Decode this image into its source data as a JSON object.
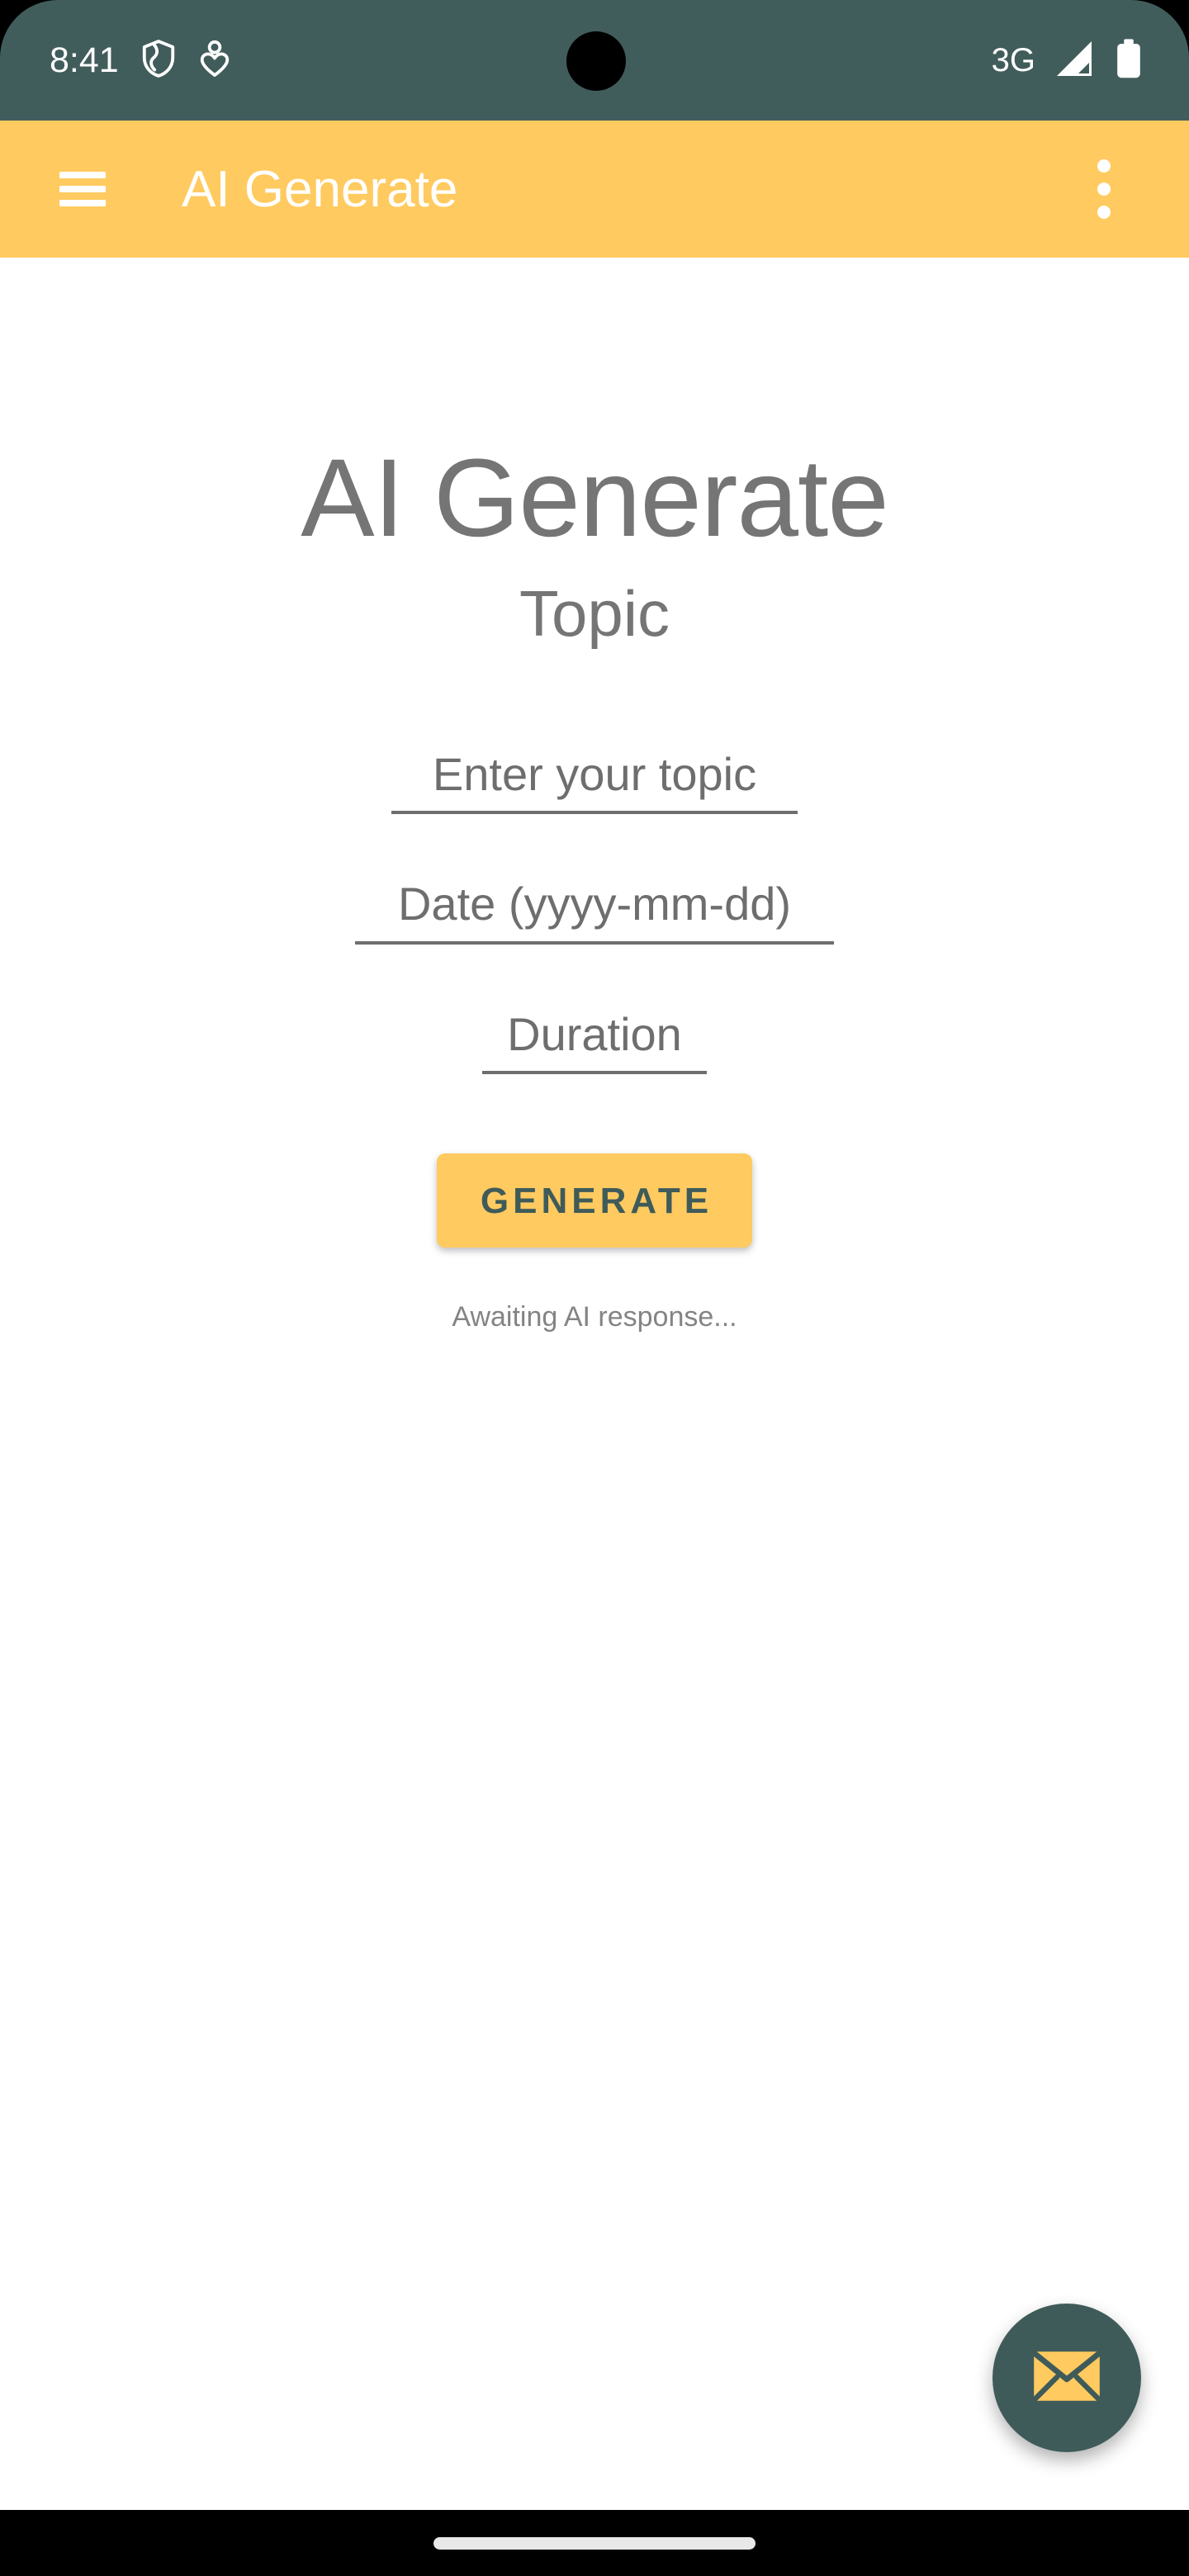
{
  "status_bar": {
    "time": "8:41",
    "network_type": "3G",
    "icons": {
      "vpn": "shield-icon",
      "person": "person-heart-icon",
      "signal": "signal-bars-icon",
      "battery": "battery-full-icon",
      "camera": "camera-cutout"
    },
    "background_color": "#415D5B",
    "foreground_color": "#FFFFFF"
  },
  "app_bar": {
    "title": "AI Generate",
    "menu_icon": "hamburger-menu-icon",
    "overflow_icon": "more-vert-icon",
    "background_color": "#FFCA5F",
    "title_color": "#FFFFFF"
  },
  "main": {
    "page_title": "AI Generate",
    "section_subtitle": "Topic",
    "fields": [
      {
        "name": "topic",
        "value": "",
        "placeholder": "Enter your topic"
      },
      {
        "name": "date",
        "value": "",
        "placeholder": "Date (yyyy-mm-dd)"
      },
      {
        "name": "duration",
        "value": "",
        "placeholder": "Duration"
      }
    ],
    "generate_button": {
      "label": "GENERATE",
      "background_color": "#FFCA5F",
      "text_color": "#3F5B59"
    },
    "status_text": "Awaiting AI response..."
  },
  "fab": {
    "icon": "envelope-icon",
    "background_color": "#3F5B59",
    "icon_color": "#FFCA5F"
  },
  "nav_bar": {
    "gesture_pill": "home-gesture-pill",
    "background_color": "#000000"
  }
}
